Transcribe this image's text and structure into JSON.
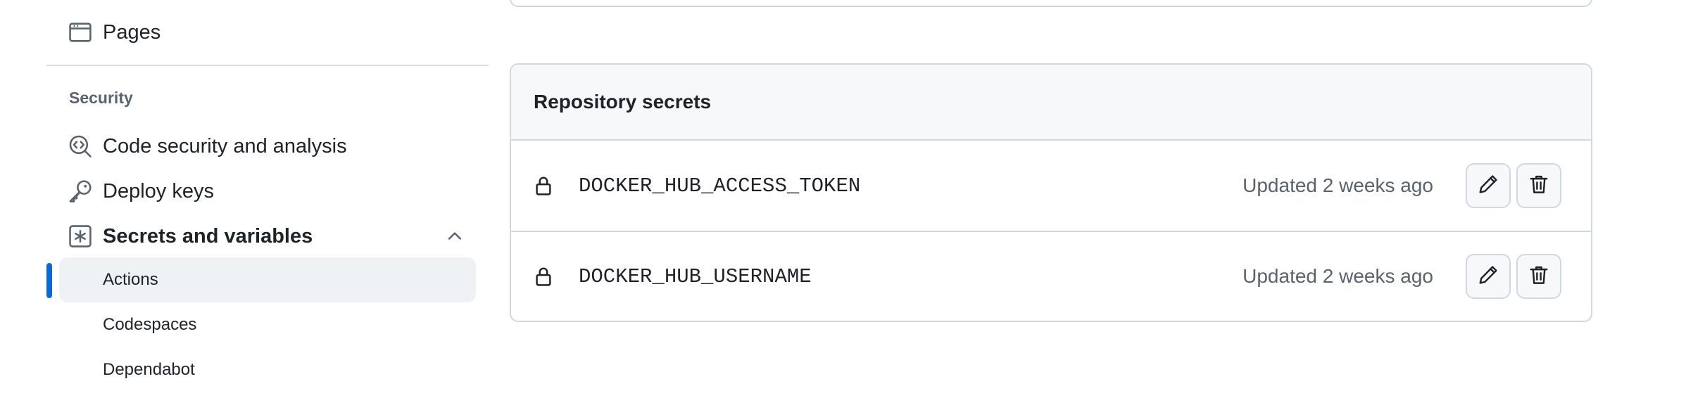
{
  "sidebar": {
    "pages_label": "Pages",
    "security_heading": "Security",
    "items": [
      {
        "label": "Code security and analysis",
        "icon": "codescan-icon"
      },
      {
        "label": "Deploy keys",
        "icon": "key-icon"
      },
      {
        "label": "Secrets and variables",
        "icon": "asterisk-icon"
      }
    ],
    "sub_items": [
      {
        "label": "Actions",
        "active": true
      },
      {
        "label": "Codespaces",
        "active": false
      },
      {
        "label": "Dependabot",
        "active": false
      }
    ]
  },
  "secrets": {
    "title": "Repository secrets",
    "rows": [
      {
        "name": "DOCKER_HUB_ACCESS_TOKEN",
        "updated": "Updated 2 weeks ago"
      },
      {
        "name": "DOCKER_HUB_USERNAME",
        "updated": "Updated 2 weeks ago"
      }
    ]
  },
  "colors": {
    "accent": "#0969da",
    "border": "#d1d9e0",
    "muted_text": "#59636e",
    "header_bg": "#f6f8fa",
    "active_bg": "#eff2f5"
  }
}
